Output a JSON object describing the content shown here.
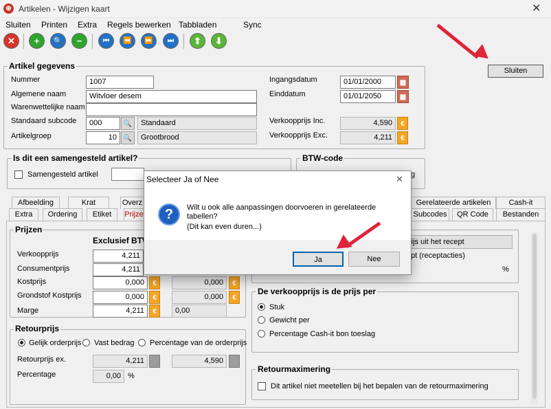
{
  "window": {
    "title": "Artikelen - Wijzigen kaart",
    "close": "✕"
  },
  "menu": [
    "Sluiten",
    "Printen",
    "Extra",
    "Regels bewerken",
    "Tabbladen",
    "Sync"
  ],
  "toolbar": {
    "close": "✕",
    "add": "+",
    "search": "🔍",
    "remove": "−",
    "first": "⏮",
    "prev": "⏪",
    "next": "⏩",
    "last": "⏭",
    "up": "⬆",
    "down": "⬇"
  },
  "sluiten_button": "Sluiten",
  "artikel": {
    "title": "Artikel gegevens",
    "nummer_label": "Nummer",
    "nummer": "1007",
    "naam_label": "Algemene naam",
    "naam": "Witvloer desem",
    "warenwet_label": "Warenwettelijke naam",
    "warenwet": "",
    "subcode_label": "Standaard subcode",
    "subcode": "000",
    "subcode_name": "Standaard",
    "groep_label": "Artikelgroep",
    "groep": "10",
    "groep_name": "Grootbrood",
    "ingang_label": "Ingangsdatum",
    "ingang": "01/01/2000",
    "eind_label": "Einddatum",
    "eind": "01/01/2050",
    "vp_inc_label": "Verkoopprijs Inc.",
    "vp_inc": "4,590",
    "vp_exc_label": "Verkoopprijs Exc.",
    "vp_exc": "4,211"
  },
  "samengesteld": {
    "title": "Is dit een samengesteld artikel?",
    "check_label": "Samengesteld artikel"
  },
  "btw": {
    "title": "BTW-code",
    "fragment": "g"
  },
  "tabs_row1": [
    "Afbeelding",
    "Krat",
    "Overz",
    "Gerelateerde artikelen",
    "Cash-it"
  ],
  "tabs_row2": [
    "Extra",
    "Ordering",
    "Etiket",
    "Prijze",
    "Subcodes",
    "QR Code",
    "Bestanden"
  ],
  "prijzen": {
    "title": "Prijzen",
    "col_excl": "Exclusief BTW",
    "rows": [
      {
        "label": "Verkoopprijs",
        "excl": "4,211",
        "incl": ""
      },
      {
        "label": "Consumentprijs",
        "excl": "4,211",
        "incl": ""
      },
      {
        "label": "Kostprijs",
        "excl": "0,000",
        "incl": "0,000"
      },
      {
        "label": "Grondstof Kostprijs",
        "excl": "0,000",
        "incl": "0,000"
      },
      {
        "label": "Marge",
        "excl": "4,211",
        "incl": "0,00"
      }
    ]
  },
  "recept": {
    "button": "rijs uit het recept",
    "line": "pt (receptacties)",
    "pct": "%"
  },
  "retour": {
    "title": "Retourprijs",
    "options": [
      "Gelijk orderprijs",
      "Vast bedrag",
      "Percentage van de orderprijs"
    ],
    "ex_label": "Retourprijs ex.",
    "ex": "4,211",
    "inc": "4,590",
    "pct_label": "Percentage",
    "pct": "0,00",
    "pct_sign": "%"
  },
  "per": {
    "title": "De verkoopprijs is de prijs per",
    "options": [
      "Stuk",
      "Gewicht per",
      "Percentage Cash-it bon toeslag"
    ]
  },
  "retourmax": {
    "title": "Retourmaximering",
    "check_label": "Dit artikel niet meetellen bij het bepalen van de retourmaximering"
  },
  "dialog": {
    "title": "Selecteer Ja of Nee",
    "close": "✕",
    "message": "Wilt u ook alle aanpassingen doorvoeren in gerelateerde tabellen?",
    "sub": "(Dit kan even duren...)",
    "yes": "Ja",
    "no": "Nee",
    "icon": "?"
  },
  "colors": {
    "accent_arrow": "#e0243a",
    "app_icon": "#c9342d"
  }
}
